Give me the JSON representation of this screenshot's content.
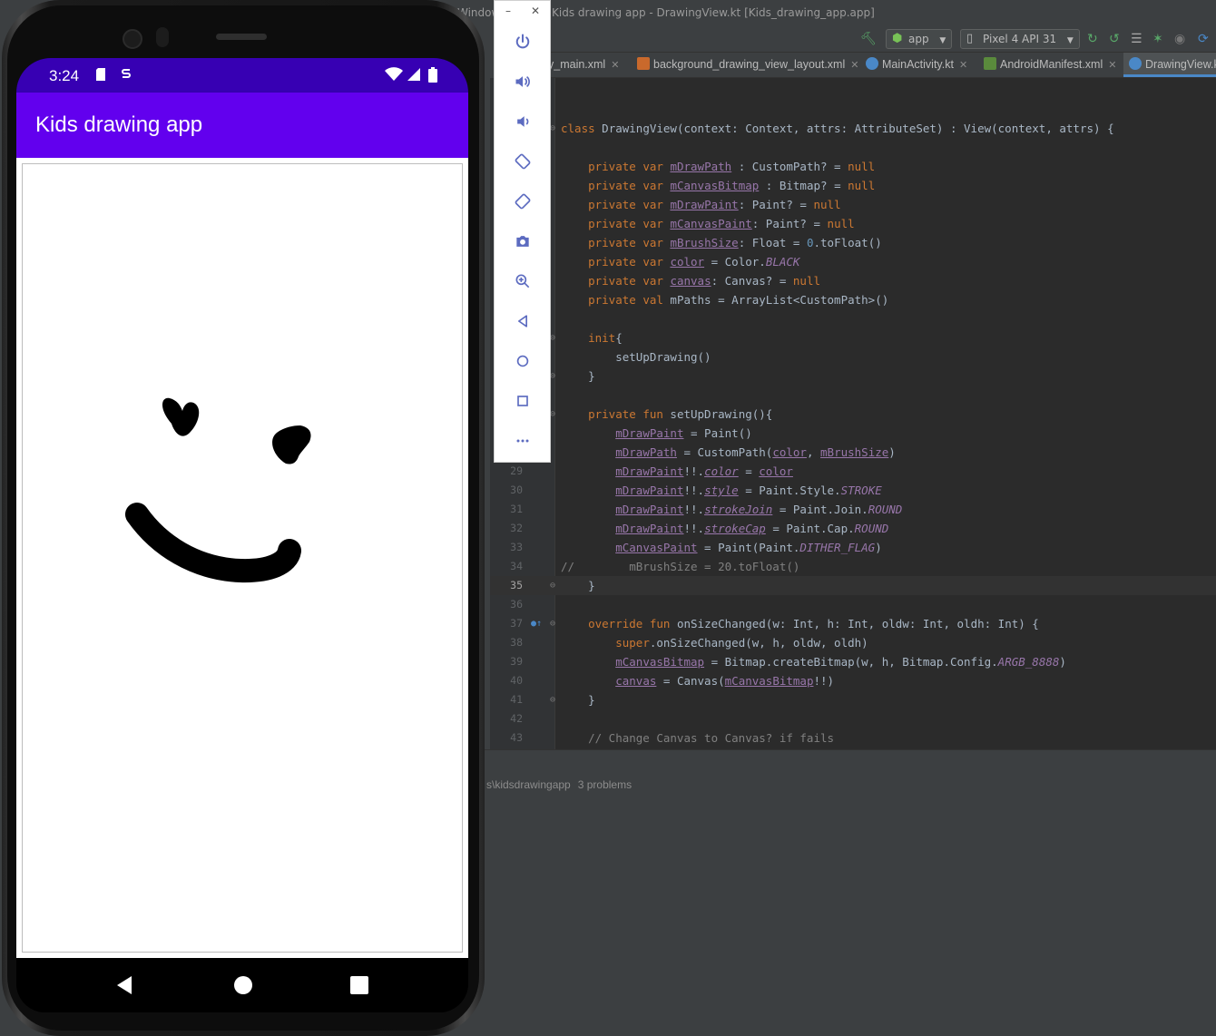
{
  "window": {
    "left_fragment": "Window",
    "title": "Kids drawing app - DrawingView.kt [Kids_drawing_app.app]"
  },
  "toolbar": {
    "run_config": "app",
    "device": "Pixel 4 API 31"
  },
  "tabs": [
    {
      "label": "y_main.xml",
      "icon": "xml-file-icon"
    },
    {
      "label": "background_drawing_view_layout.xml",
      "icon": "layout-file-icon"
    },
    {
      "label": "MainActivity.kt",
      "icon": "kotlin-file-icon"
    },
    {
      "label": "AndroidManifest.xml",
      "icon": "manifest-file-icon"
    },
    {
      "label": "DrawingView.k",
      "icon": "kotlin-file-icon",
      "active": true
    }
  ],
  "editor": {
    "current_line": "35",
    "lines": [
      {
        "num": "",
        "text": "class DrawingView(context: Context, attrs: AttributeSet) : View(context, attrs) {"
      },
      {
        "num": "",
        "text": ""
      },
      {
        "num": "",
        "text": "    private var mDrawPath : CustomPath? = null"
      },
      {
        "num": "",
        "text": "    private var mCanvasBitmap : Bitmap? = null"
      },
      {
        "num": "",
        "text": "    private var mDrawPaint: Paint? = null"
      },
      {
        "num": "",
        "text": "    private var mCanvasPaint: Paint? = null"
      },
      {
        "num": "",
        "text": "    private var mBrushSize: Float = 0.toFloat()"
      },
      {
        "num": "",
        "text": "    private var color = Color.BLACK"
      },
      {
        "num": "",
        "text": "    private var canvas: Canvas? = null"
      },
      {
        "num": "",
        "text": "    private val mPaths = ArrayList<CustomPath>()"
      },
      {
        "num": "",
        "text": ""
      },
      {
        "num": "",
        "text": "    init{"
      },
      {
        "num": "",
        "text": "        setUpDrawing()"
      },
      {
        "num": "",
        "text": "    }"
      },
      {
        "num": "",
        "text": ""
      },
      {
        "num": "",
        "text": "    private fun setUpDrawing(){"
      },
      {
        "num": "",
        "text": "        mDrawPaint = Paint()"
      },
      {
        "num": "",
        "text": "        mDrawPath = CustomPath(color, mBrushSize)"
      },
      {
        "num": "29",
        "text": "        mDrawPaint!!.color = color"
      },
      {
        "num": "30",
        "text": "        mDrawPaint!!.style = Paint.Style.STROKE"
      },
      {
        "num": "31",
        "text": "        mDrawPaint!!.strokeJoin = Paint.Join.ROUND"
      },
      {
        "num": "32",
        "text": "        mDrawPaint!!.strokeCap = Paint.Cap.ROUND"
      },
      {
        "num": "33",
        "text": "        mCanvasPaint = Paint(Paint.DITHER_FLAG)"
      },
      {
        "num": "34",
        "text": "//        mBrushSize = 20.toFloat()"
      },
      {
        "num": "35",
        "text": "    }"
      },
      {
        "num": "36",
        "text": ""
      },
      {
        "num": "37",
        "text": "    override fun onSizeChanged(w: Int, h: Int, oldw: Int, oldh: Int) {"
      },
      {
        "num": "38",
        "text": "        super.onSizeChanged(w, h, oldw, oldh)"
      },
      {
        "num": "39",
        "text": "        mCanvasBitmap = Bitmap.createBitmap(w, h, Bitmap.Config.ARGB_8888)"
      },
      {
        "num": "40",
        "text": "        canvas = Canvas(mCanvasBitmap!!)"
      },
      {
        "num": "41",
        "text": "    }"
      },
      {
        "num": "42",
        "text": ""
      },
      {
        "num": "43",
        "text": "    // Change Canvas to Canvas? if fails"
      }
    ]
  },
  "status": {
    "path": "s\\kidsdrawingapp",
    "problems": "3 problems"
  },
  "emulator_controls": [
    "power-icon",
    "volume-up-icon",
    "volume-down-icon",
    "rotate-left-icon",
    "rotate-right-icon",
    "camera-icon",
    "zoom-icon",
    "back-icon",
    "home-icon",
    "overview-icon",
    "more-icon"
  ],
  "phone": {
    "time": "3:24",
    "app_title": "Kids drawing app",
    "colors": {
      "status_bar": "#3700b3",
      "app_bar": "#6200ee",
      "stroke": "#000000"
    }
  }
}
